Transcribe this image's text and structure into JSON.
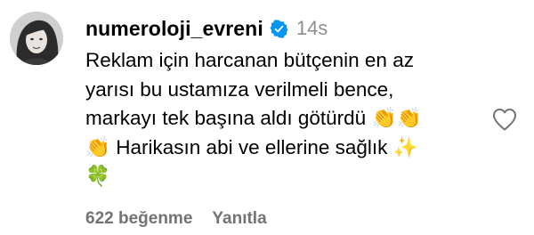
{
  "comment": {
    "username": "numeroloji_evreni",
    "verified": true,
    "timestamp": "14s",
    "text_lines": [
      "Reklam için harcanan bütçenin en az",
      "yarısı bu ustamıza verilmeli bence,",
      "markayı tek başına aldı götürdü"
    ],
    "line3_emoji": "👏👏",
    "line4_emoji_lead": "👏",
    "line4_text": " Harikasın abi ve ellerine sağlık ",
    "line4_emoji_trail": "✨",
    "line5_emoji": "🍀",
    "likes_label": "622 beğenme",
    "reply_label": "Yanıtla"
  },
  "icons": {
    "verified": "verified-badge-icon",
    "like": "heart-outline-icon"
  },
  "colors": {
    "verified_blue": "#0095f6",
    "muted_text": "#737373",
    "timestamp_gray": "#8e8e8e",
    "heart_stroke": "#737373"
  }
}
